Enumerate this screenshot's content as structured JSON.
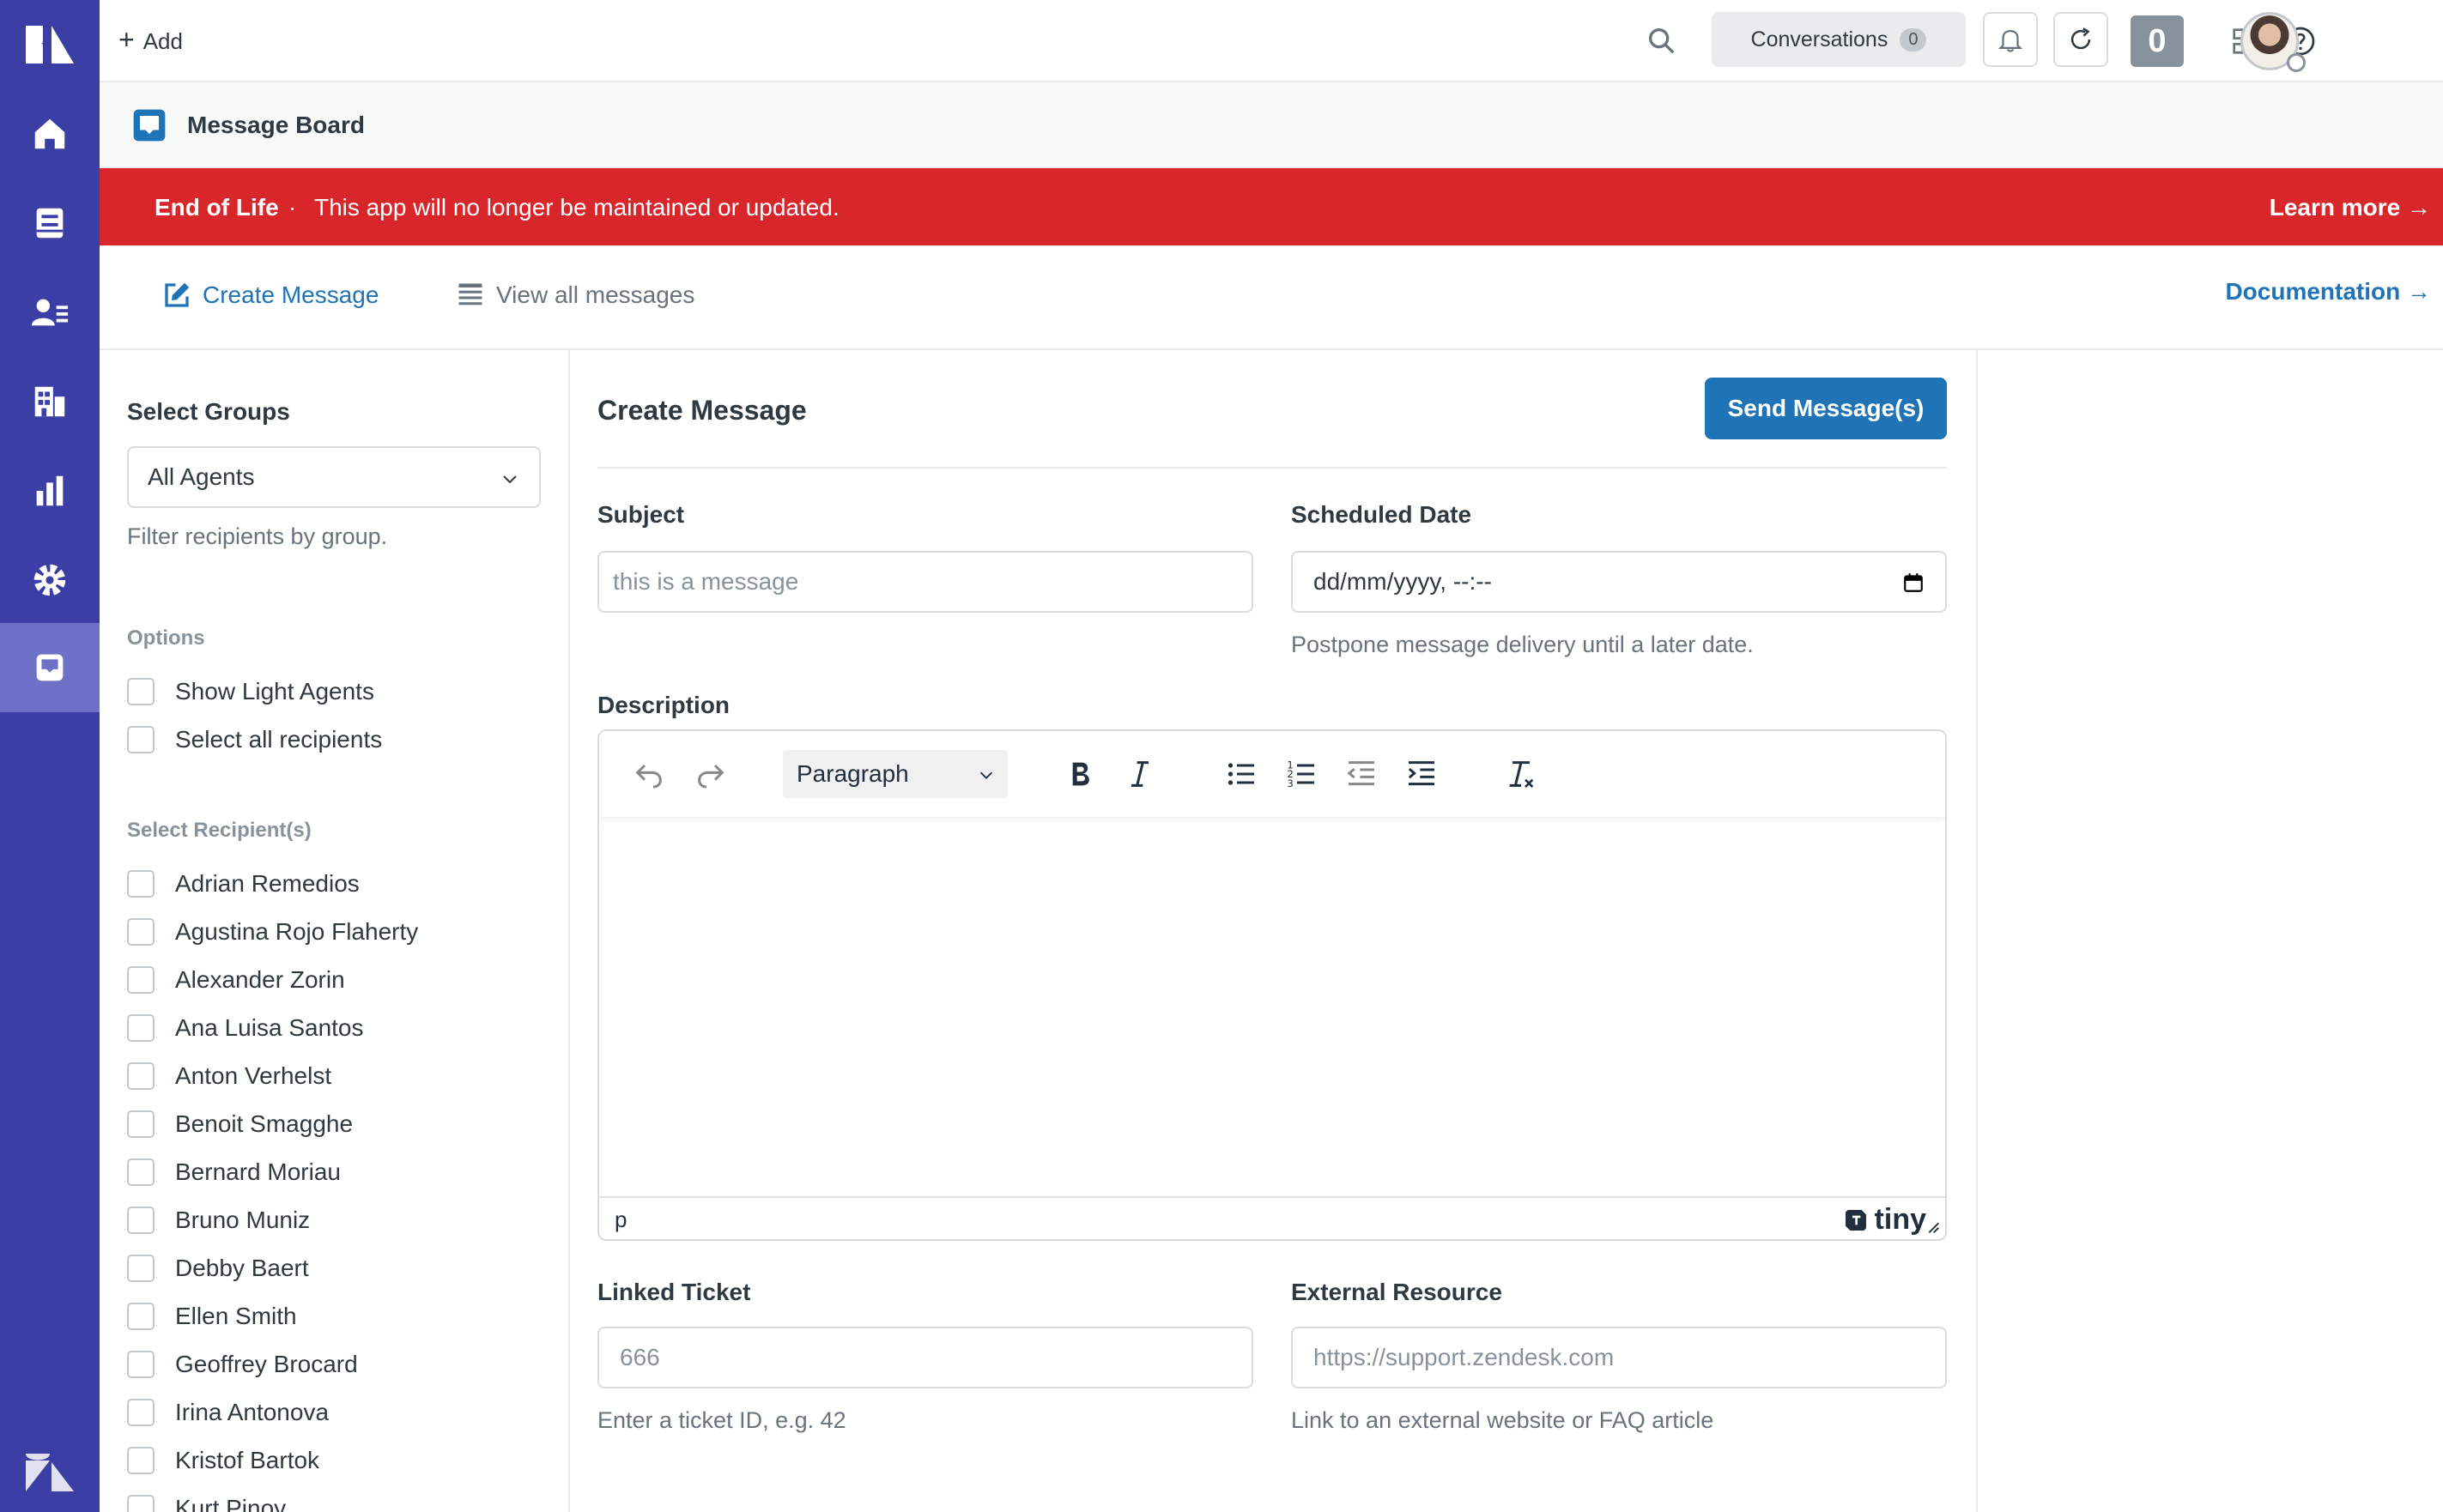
{
  "topbar": {
    "add_label": "Add",
    "conversations_label": "Conversations",
    "conversations_count": "0",
    "badge_count": "0"
  },
  "app": {
    "title": "Message Board"
  },
  "banner": {
    "title": "End of Life",
    "separator": "·",
    "message": "This app will no longer be maintained or updated.",
    "link": "Learn more →"
  },
  "nav": {
    "create": "Create Message",
    "view_all": "View all messages",
    "documentation": "Documentation →"
  },
  "filters": {
    "groups_label": "Select Groups",
    "groups_value": "All Agents",
    "groups_hint": "Filter recipients by group.",
    "options_title": "Options",
    "options": [
      "Show Light Agents",
      "Select all recipients"
    ],
    "recipients_title": "Select Recipient(s)",
    "recipients": [
      "Adrian Remedios",
      "Agustina Rojo Flaherty",
      "Alexander Zorin",
      "Ana Luisa Santos",
      "Anton Verhelst",
      "Benoit Smagghe",
      "Bernard Moriau",
      "Bruno Muniz",
      "Debby Baert",
      "Ellen Smith",
      "Geoffrey Brocard",
      "Irina Antonova",
      "Kristof Bartok",
      "Kurt Pinoy"
    ]
  },
  "form": {
    "title": "Create Message",
    "send_button": "Send Message(s)",
    "subject_label": "Subject",
    "subject_placeholder": "this is a message",
    "date_label": "Scheduled Date",
    "date_value": "dd/mm/yyyy, --:--",
    "date_hint": "Postpone message delivery until a later date.",
    "description_label": "Description",
    "editor_block_format": "Paragraph",
    "editor_path": "p",
    "editor_brand": "tiny",
    "ticket_label": "Linked Ticket",
    "ticket_placeholder": "666",
    "ticket_hint": "Enter a ticket ID, e.g. 42",
    "resource_label": "External Resource",
    "resource_placeholder": "https://support.zendesk.com",
    "resource_hint": "Link to an external website or FAQ article"
  },
  "colors": {
    "rail": "#3b3ea4",
    "rail_active": "#6e71c7",
    "banner": "#d9262a",
    "primary": "#1f73b7"
  }
}
